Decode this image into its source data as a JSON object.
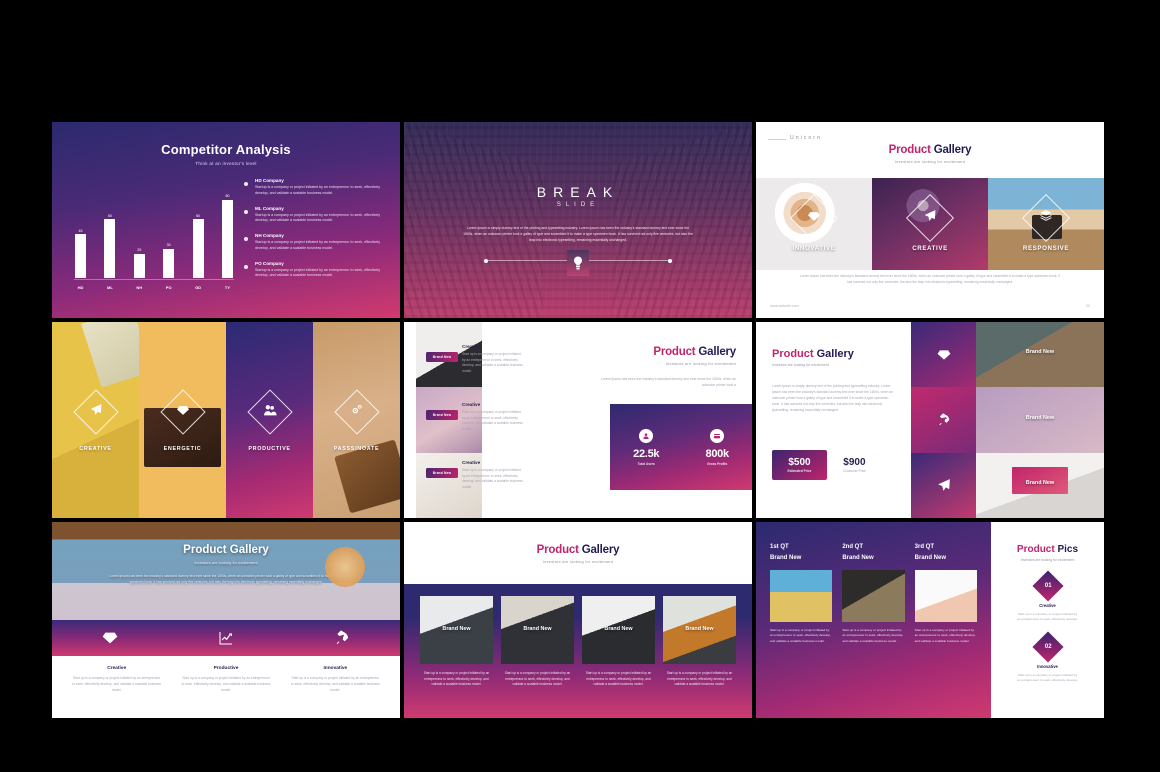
{
  "slides": {
    "competitor": {
      "title": "Competitor Analysis",
      "subtitle": "Think at an investor's level",
      "legend": [
        {
          "title": "HD Company",
          "text": "Startup is a company or project initiated by an entrepreneur to seek, effectively develop, and validate a scalable business model."
        },
        {
          "title": "ML Company",
          "text": "Startup is a company or project initiated by an entrepreneur to seek, effectively develop, and validate a scalable business model."
        },
        {
          "title": "NH Company",
          "text": "Startup is a company or project initiated by an entrepreneur to seek, effectively develop, and validate a scalable business model."
        },
        {
          "title": "PO Company",
          "text": "Startup is a company or project initiated by an entrepreneur to seek, effectively develop, and validate a scalable business model."
        }
      ]
    },
    "breakslide": {
      "title": "BREAK",
      "subtitle": "SLIDE",
      "body": "Lorem Ipsum is simply dummy text of the printing and typesetting industry. Lorem Ipsum has been the industry's standard dummy text ever since the 1500s, when an unknown printer took a galley of type and scrambled it to make a type specimen book. It has survived not only five centuries, but also the leap into electronic typesetting, remaining essentially unchanged."
    },
    "gallery_unicorn": {
      "brand": "Unicorn",
      "title_a": "Product",
      "title_b": "Gallery",
      "subtitle": "Investors are looking for excitement",
      "cards": [
        {
          "label": "INNOVATIVE",
          "icon": "diamond-icon"
        },
        {
          "label": "CREATIVE",
          "icon": "paper-plane-icon"
        },
        {
          "label": "RESPONSIVE",
          "icon": "layers-icon"
        }
      ],
      "footer_text": "Lorem Ipsum has been the industry's standard dummy text ever since the 1500s, when an unknown printer took a galley of type and scrambled it to make a type specimen book. It has survived not only five centuries, but also the leap into electronic typesetting, remaining essentially unchanged.",
      "url": "www.website.com",
      "page": "30"
    },
    "columns": {
      "items": [
        {
          "label": "CREATIVE",
          "icon": "paper-plane-icon"
        },
        {
          "label": "ENERGETIC",
          "icon": "diamond-icon"
        },
        {
          "label": "PRODUCTIVE",
          "icon": "people-icon"
        },
        {
          "label": "PASSSINOATE",
          "icon": "gears-icon"
        }
      ]
    },
    "gallery_stats": {
      "title_a": "Product",
      "title_b": "Gallery",
      "subtitle": "Investors are looking for excitement",
      "body": "Lorem Ipsum has been the industry's standard dummy text ever since the 1500s, when an unknown printer took a",
      "rows": [
        {
          "badge": "Brand New",
          "title": "Creative",
          "text": "Start up is a company or project initiated by an entrepreneur to seek, effectively develop, and validate a scalable business model."
        },
        {
          "badge": "Brand New",
          "title": "Creative",
          "text": "Start up is a company or project initiated by an entrepreneur to seek, effectively develop, and validate a scalable business model."
        },
        {
          "badge": "Brand New",
          "title": "Creative",
          "text": "Start up is a company or project initiated by an entrepreneur to seek, effectively develop, and validate a scalable business model."
        }
      ],
      "stats": [
        {
          "value": "22.5k",
          "label": "Total Users",
          "icon": "users-icon"
        },
        {
          "value": "800k",
          "label": "Gross Profits",
          "icon": "wallet-icon"
        }
      ]
    },
    "pricing": {
      "title_a": "Product",
      "title_b": "Gallery",
      "subtitle": "Investors are looking for excitement",
      "body": "Lorem Ipsum is simply dummy text of the printing and typesetting industry. Lorem Ipsum has been the industry's standard dummy text ever since the 1500s, when an unknown printer took a galley of type and scrambled it to make a type specimen book. It has survived not only five centuries, but also the leap into electronic typesetting, remaining essentially unchanged.",
      "price_primary": {
        "value": "$500",
        "label": "Estimated Price"
      },
      "price_secondary": {
        "value": "$900",
        "label": "Consumer Price"
      },
      "icons": [
        "diamond-icon",
        "rocket-icon",
        "paper-plane-icon"
      ],
      "image_labels": [
        "Brand New",
        "Brand New",
        "Brand New"
      ]
    },
    "hero_features": {
      "title": "Product Gallery",
      "subtitle": "Investors are looking for excitement",
      "body": "Lorem Ipsum has been the industry's standard dummy text ever since the 1500s, when an unknown printer took a galley of type and scrambled it to make a type specimen book. It has survived not only five centuries, but also the leap into electronic typesetting, remaining essentially unchanged.",
      "features": [
        {
          "icon": "diamond-icon",
          "title": "Creative",
          "text": "Start up is a company or project initiated by an entrepreneur to seek, effectively develop, and validate a scalable business model."
        },
        {
          "icon": "chart-icon",
          "title": "Productive",
          "text": "Start up is a company or project initiated by an entrepreneur to seek, effectively develop, and validate a scalable business model."
        },
        {
          "icon": "rocket-icon",
          "title": "Innovative",
          "text": "Start up is a company or project initiated by an entrepreneur to seek, effectively develop, and validate a scalable business model."
        }
      ]
    },
    "gallery_cards": {
      "title_a": "Product",
      "title_b": "Gallery",
      "subtitle": "Investors are looking for excitement",
      "cards": [
        {
          "label": "Brand New",
          "text": "Start up is a company or project initiated by an entrepreneur to seek, effectively develop, and validate a scalable business model."
        },
        {
          "label": "Brand New",
          "text": "Start up is a company or project initiated by an entrepreneur to seek, effectively develop, and validate a scalable business model."
        },
        {
          "label": "Brand New",
          "text": "Start up is a company or project initiated by an entrepreneur to seek, effectively develop, and validate a scalable business model."
        },
        {
          "label": "Brand New",
          "text": "Start up is a company or project initiated by an entrepreneur to seek, effectively develop, and validate a scalable business model."
        }
      ]
    },
    "product_pics": {
      "title_a": "Product",
      "title_b": "Pics",
      "subtitle": "Investors are looking for excitement",
      "quarters": [
        {
          "q": "1st QT",
          "label": "Brand New",
          "text": "Start up is a company or project initiated by an entrepreneur to seek, effectively develop, and validate a scalable business model."
        },
        {
          "q": "2nd QT",
          "label": "Brand New",
          "text": "Start up is a company or project initiated by an entrepreneur to seek, effectively develop, and validate a scalable business model."
        },
        {
          "q": "3rd QT",
          "label": "Brand New",
          "text": "Start up is a company or project initiated by an entrepreneur to seek, effectively develop, and validate a scalable business model."
        }
      ],
      "items": [
        {
          "num": "01",
          "title": "Creative",
          "text": "Start up is a company or project initiated by an entrepreneur to seek, effectively develop."
        },
        {
          "num": "02",
          "title": "Innovative",
          "text": "Start up is a company or project initiated by an entrepreneur to seek, effectively develop."
        }
      ]
    }
  },
  "colors": {
    "accent_magenta": "#c0246b",
    "accent_navy": "#221c55",
    "gradient_start": "#2b2a70",
    "gradient_end": "#cf3a70"
  },
  "chart_data": {
    "type": "bar",
    "title": "Competitor Analysis",
    "subtitle": "Think at an investor's level",
    "categories": [
      "HD",
      "ML",
      "NH",
      "PO",
      "GD",
      "TY"
    ],
    "values": [
      45,
      60,
      25,
      30,
      60,
      80
    ],
    "xlabel": "",
    "ylabel": "",
    "ylim": [
      0,
      90
    ],
    "grid": false,
    "legend_position": "right",
    "bar_color": "#ffffff"
  }
}
